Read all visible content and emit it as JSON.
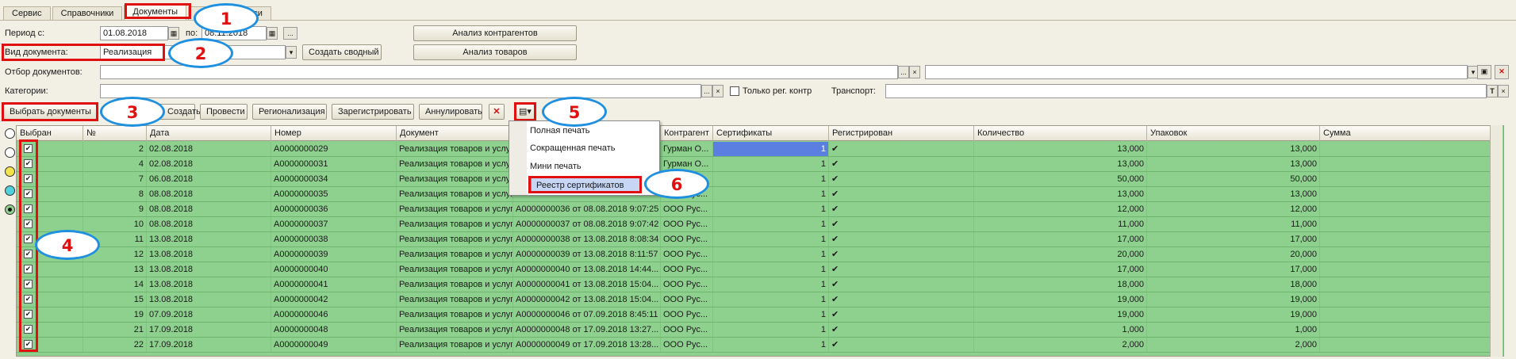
{
  "tabs": [
    "Сервис",
    "Справочники",
    "Документы",
    "...писи"
  ],
  "filters": {
    "period_label": "Период с:",
    "period_from": "01.08.2018",
    "period_to_label": "по:",
    "period_to": "08.11.2018",
    "ellipsis": "...",
    "doc_type_label": "Вид документа:",
    "doc_type_value": "Реализация",
    "create_summary": "Создать сводный",
    "analysis_contractors": "Анализ контрагентов",
    "analysis_goods": "Анализ товаров",
    "doc_filter_label": "Отбор документов:",
    "categories_label": "Категории:",
    "only_reg_label": "Только рег. контр",
    "transport_label": "Транспорт:",
    "ellipsis_x": "...",
    "clear_x": "×",
    "t_label": "T",
    "x_label": "×"
  },
  "toolbar": {
    "select_docs": "Выбрать документы",
    "create": "Создать",
    "post": "Провести",
    "regionalize": "Регионализация",
    "register": "Зарегистрировать",
    "annul": "Аннулировать"
  },
  "print_menu": {
    "items": [
      "Полная печать",
      "Сокращенная печать",
      "Мини печать",
      "Реестр сертификатов"
    ]
  },
  "callouts": [
    "1",
    "2",
    "3",
    "4",
    "5",
    "6"
  ],
  "grid": {
    "columns": [
      "Выбран",
      "№",
      "Дата",
      "Номер",
      "Документ",
      "",
      "Контрагент",
      "Сертификаты",
      "Регистрирован",
      "Количество",
      "Упаковок",
      "Сумма"
    ],
    "rows": [
      {
        "n": "2",
        "date": "02.08.2018",
        "num": "А0000000029",
        "doc": "Реализация товаров и услуг",
        "doc2": "",
        "contr": "Гурман О...",
        "cert": "1",
        "qty": "13,000",
        "pack": "13,000"
      },
      {
        "n": "4",
        "date": "02.08.2018",
        "num": "А0000000031",
        "doc": "Реализация товаров и услуг",
        "doc2": "",
        "contr": "Гурман О...",
        "cert": "1",
        "qty": "13,000",
        "pack": "13,000"
      },
      {
        "n": "7",
        "date": "06.08.2018",
        "num": "А0000000034",
        "doc": "Реализация товаров и услуг",
        "doc2": "",
        "contr": "ООО Рус...",
        "cert": "1",
        "qty": "50,000",
        "pack": "50,000"
      },
      {
        "n": "8",
        "date": "08.08.2018",
        "num": "А0000000035",
        "doc": "Реализация товаров и услуг",
        "doc2": "",
        "contr": "ООО Рус...",
        "cert": "1",
        "qty": "13,000",
        "pack": "13,000"
      },
      {
        "n": "9",
        "date": "08.08.2018",
        "num": "А0000000036",
        "doc": "Реализация товаров и услуг",
        "doc2": "А0000000036 от 08.08.2018 9:07:25",
        "contr": "ООО Рус...",
        "cert": "1",
        "qty": "12,000",
        "pack": "12,000"
      },
      {
        "n": "10",
        "date": "08.08.2018",
        "num": "А0000000037",
        "doc": "Реализация товаров и услуг",
        "doc2": "А0000000037 от 08.08.2018 9:07:42",
        "contr": "ООО Рус...",
        "cert": "1",
        "qty": "11,000",
        "pack": "11,000"
      },
      {
        "n": "11",
        "date": "13.08.2018",
        "num": "А0000000038",
        "doc": "Реализация товаров и услуг",
        "doc2": "А0000000038 от 13.08.2018 8:08:34",
        "contr": "ООО Рус...",
        "cert": "1",
        "qty": "17,000",
        "pack": "17,000"
      },
      {
        "n": "12",
        "date": "13.08.2018",
        "num": "А0000000039",
        "doc": "Реализация товаров и услуг",
        "doc2": "А0000000039 от 13.08.2018 8:11:57",
        "contr": "ООО Рус...",
        "cert": "1",
        "qty": "20,000",
        "pack": "20,000"
      },
      {
        "n": "13",
        "date": "13.08.2018",
        "num": "А0000000040",
        "doc": "Реализация товаров и услуг",
        "doc2": "А0000000040 от 13.08.2018 14:44...",
        "contr": "ООО Рус...",
        "cert": "1",
        "qty": "17,000",
        "pack": "17,000"
      },
      {
        "n": "14",
        "date": "13.08.2018",
        "num": "А0000000041",
        "doc": "Реализация товаров и услуг",
        "doc2": "А0000000041 от 13.08.2018 15:04...",
        "contr": "ООО Рус...",
        "cert": "1",
        "qty": "18,000",
        "pack": "18,000"
      },
      {
        "n": "15",
        "date": "13.08.2018",
        "num": "А0000000042",
        "doc": "Реализация товаров и услуг",
        "doc2": "А0000000042 от 13.08.2018 15:04...",
        "contr": "ООО Рус...",
        "cert": "1",
        "qty": "19,000",
        "pack": "19,000"
      },
      {
        "n": "19",
        "date": "07.09.2018",
        "num": "А0000000046",
        "doc": "Реализация товаров и услуг",
        "doc2": "А0000000046 от 07.09.2018 8:45:11",
        "contr": "ООО Рус...",
        "cert": "1",
        "qty": "19,000",
        "pack": "19,000"
      },
      {
        "n": "21",
        "date": "17.09.2018",
        "num": "А0000000048",
        "doc": "Реализация товаров и услуг",
        "doc2": "А0000000048 от 17.09.2018 13:27...",
        "contr": "ООО Рус...",
        "cert": "1",
        "qty": "1,000",
        "pack": "1,000"
      },
      {
        "n": "22",
        "date": "17.09.2018",
        "num": "А0000000049",
        "doc": "Реализация товаров и услуг",
        "doc2": "А0000000049 от 17.09.2018 13:28...",
        "contr": "ООО Рус...",
        "cert": "1",
        "qty": "2,000",
        "pack": "2,000"
      }
    ]
  },
  "colors": {
    "row_green": "#8ed18e",
    "highlight_red": "#e01010",
    "callout_blue": "#1f8fe0"
  },
  "icons": {
    "calendar": "calendar-icon",
    "print": "printer-icon",
    "dropdown": "chevron-down-icon",
    "delete": "delete-red-icon",
    "check": "checkmark-icon"
  }
}
